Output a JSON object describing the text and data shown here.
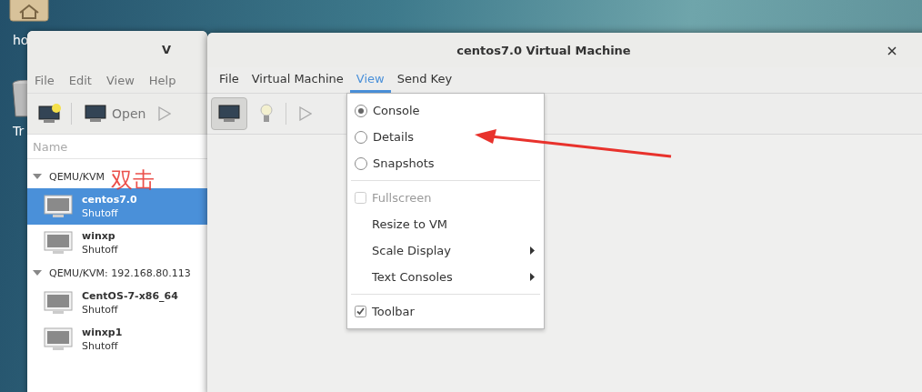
{
  "desktop": {
    "icons": [
      {
        "kind": "home",
        "label": "ho"
      },
      {
        "kind": "trash",
        "label": "Tr"
      }
    ]
  },
  "manager_window": {
    "title": "V",
    "menu": [
      "File",
      "Edit",
      "View",
      "Help"
    ],
    "toolbar": {
      "open_label": "Open"
    },
    "column_header": "Name",
    "connections": [
      {
        "name": "QEMU/KVM",
        "expanded": true,
        "vms": [
          {
            "name": "centos7.0",
            "status": "Shutoff",
            "selected": true
          },
          {
            "name": "winxp",
            "status": "Shutoff",
            "selected": false
          }
        ]
      },
      {
        "name": "QEMU/KVM: 192.168.80.113",
        "expanded": true,
        "vms": [
          {
            "name": "CentOS-7-x86_64",
            "status": "Shutoff",
            "selected": false
          },
          {
            "name": "winxp1",
            "status": "Shutoff",
            "selected": false
          }
        ]
      }
    ]
  },
  "vm_window": {
    "title": "centos7.0 Virtual Machine",
    "menu": [
      {
        "label": "File",
        "selected": false
      },
      {
        "label": "Virtual Machine",
        "selected": false
      },
      {
        "label": "View",
        "selected": true
      },
      {
        "label": "Send Key",
        "selected": false
      }
    ],
    "toolbar": {
      "console_pressed": true
    }
  },
  "view_menu": [
    {
      "kind": "radio",
      "label": "Console",
      "checked": true
    },
    {
      "kind": "radio",
      "label": "Details",
      "checked": false
    },
    {
      "kind": "radio",
      "label": "Snapshots",
      "checked": false
    },
    {
      "kind": "separator"
    },
    {
      "kind": "check",
      "label": "Fullscreen",
      "checked": false,
      "disabled": true
    },
    {
      "kind": "plain",
      "label": "Resize to VM"
    },
    {
      "kind": "submenu",
      "label": "Scale Display"
    },
    {
      "kind": "submenu",
      "label": "Text Consoles"
    },
    {
      "kind": "separator"
    },
    {
      "kind": "check",
      "label": "Toolbar",
      "checked": true,
      "disabled": false
    }
  ],
  "annotation": {
    "text": "双击"
  }
}
